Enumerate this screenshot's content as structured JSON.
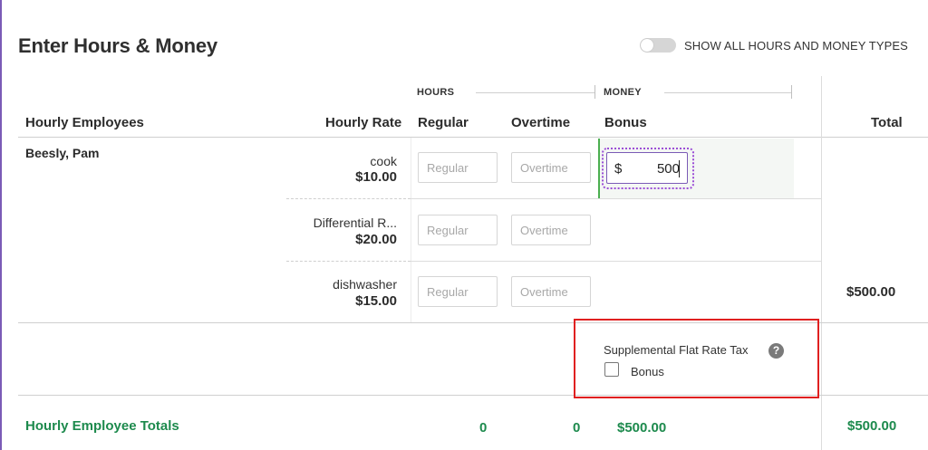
{
  "page": {
    "title": "Enter Hours & Money",
    "toggle_label": "SHOW ALL HOURS AND MONEY TYPES"
  },
  "groups": {
    "hours": "HOURS",
    "money": "MONEY"
  },
  "columns": {
    "employees": "Hourly Employees",
    "hourly_rate": "Hourly Rate",
    "regular": "Regular",
    "overtime": "Overtime",
    "bonus": "Bonus",
    "total": "Total"
  },
  "employee": {
    "name": "Beesly, Pam",
    "total": "$500.00",
    "jobs": [
      {
        "title": "cook",
        "rate": "$10.00",
        "regular_placeholder": "Regular",
        "overtime_placeholder": "Overtime"
      },
      {
        "title": "Differential R...",
        "rate": "$20.00",
        "regular_placeholder": "Regular",
        "overtime_placeholder": "Overtime"
      },
      {
        "title": "dishwasher",
        "rate": "$15.00",
        "regular_placeholder": "Regular",
        "overtime_placeholder": "Overtime"
      }
    ],
    "bonus": {
      "currency": "$",
      "value": "500"
    }
  },
  "tax": {
    "label": "Supplemental Flat Rate Tax",
    "help": "?",
    "checkbox_label": "Bonus",
    "checked": false
  },
  "totals": {
    "label": "Hourly Employee Totals",
    "regular": "0",
    "overtime": "0",
    "bonus": "$500.00",
    "total": "$500.00"
  }
}
